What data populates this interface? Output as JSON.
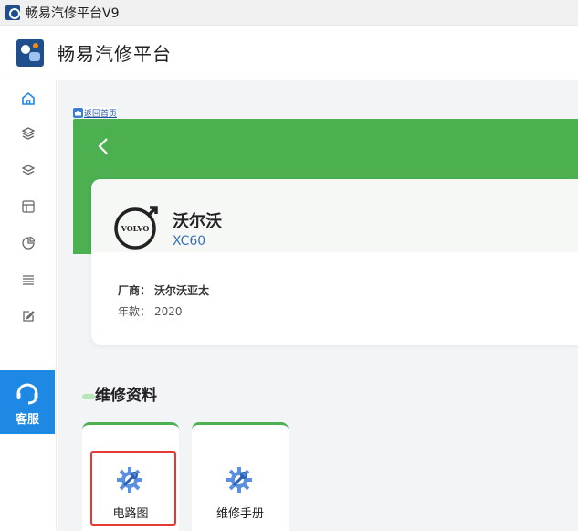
{
  "window": {
    "title": "畅易汽修平台V9"
  },
  "header": {
    "app_name": "畅易汽修平台"
  },
  "sidebar": {
    "items": [
      {
        "icon": "home-icon"
      },
      {
        "icon": "layers-icon"
      },
      {
        "icon": "layers-alt-icon"
      },
      {
        "icon": "layout-icon"
      },
      {
        "icon": "pie-chart-icon"
      },
      {
        "icon": "menu-icon"
      },
      {
        "icon": "edit-icon"
      }
    ],
    "service": {
      "label": "客服",
      "icon": "headset-icon"
    }
  },
  "breadcrumb": {
    "back_home": "返回首页"
  },
  "vehicle": {
    "brand": "沃尔沃",
    "model": "XC60",
    "logo_text": "VOLVO",
    "manufacturer_label": "厂商：",
    "manufacturer": "沃尔沃亚太",
    "year_label": "年款：",
    "year": "2020"
  },
  "section": {
    "title": "维修资料"
  },
  "tiles": [
    {
      "label": "电路图",
      "icon": "gear-wrench-icon"
    },
    {
      "label": "维修手册",
      "icon": "gear-wrench-icon"
    }
  ],
  "colors": {
    "accent_green": "#4caf50",
    "accent_blue": "#1e88e5",
    "highlight_red": "#e53935"
  }
}
